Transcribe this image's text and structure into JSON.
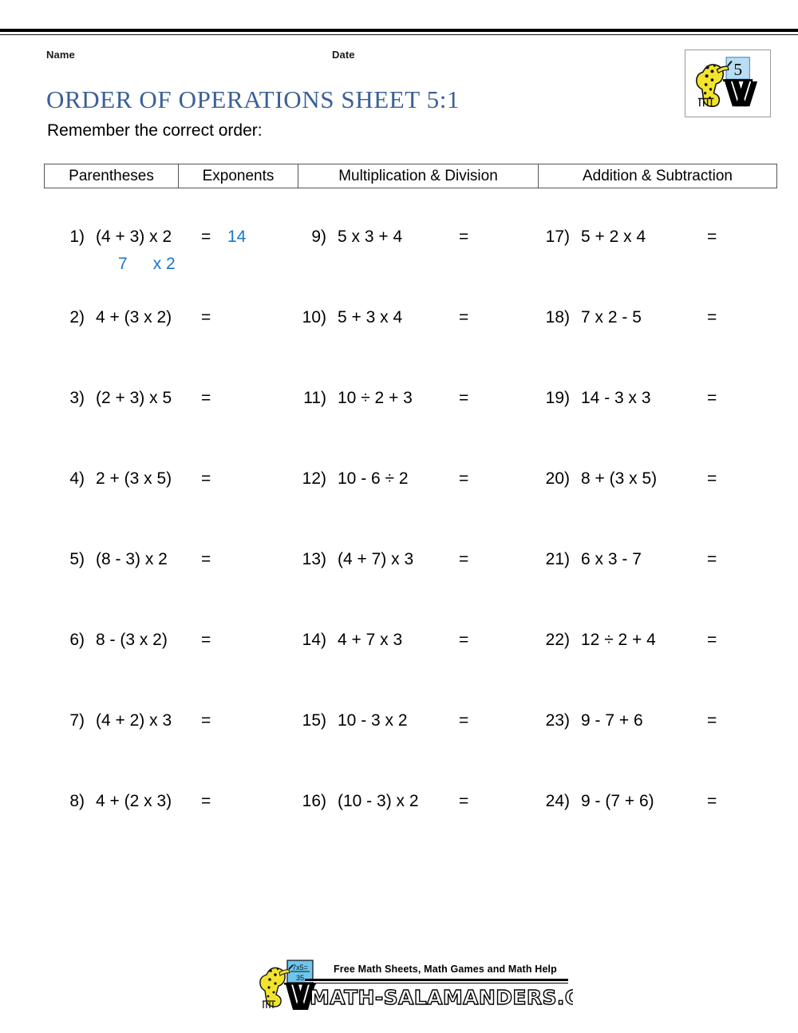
{
  "meta": {
    "name_label": "Name",
    "date_label": "Date"
  },
  "header": {
    "title": "ORDER OF OPERATIONS SHEET 5:1",
    "subtitle": "Remember the correct order:"
  },
  "order_table": {
    "cells": [
      "Parentheses",
      "Exponents",
      "Multiplication & Division",
      "Addition & Subtraction"
    ]
  },
  "badge": {
    "number": "5",
    "alt": "math-salamanders-grade-5-badge"
  },
  "colors": {
    "title_blue": "#3a6097",
    "answer_blue": "#1878c8",
    "board_blue": "#a8d8ef",
    "salamander_yellow": "#f2e42c",
    "rule_black": "#000000"
  },
  "columns": [
    {
      "rows": [
        {
          "num": "1)",
          "expr": "(4 + 3) x 2",
          "eq": "=",
          "answer": "14",
          "work": {
            "left": "7",
            "right": "x 2"
          }
        },
        {
          "num": "2)",
          "expr": "4 + (3 x 2)",
          "eq": "=",
          "answer": ""
        },
        {
          "num": "3)",
          "expr": "(2 + 3) x 5",
          "eq": "=",
          "answer": ""
        },
        {
          "num": "4)",
          "expr": "2 + (3 x 5)",
          "eq": "=",
          "answer": ""
        },
        {
          "num": "5)",
          "expr": "(8 - 3) x 2",
          "eq": "=",
          "answer": ""
        },
        {
          "num": "6)",
          "expr": "8 - (3 x 2)",
          "eq": "=",
          "answer": ""
        },
        {
          "num": "7)",
          "expr": "(4 + 2) x 3",
          "eq": "=",
          "answer": ""
        },
        {
          "num": "8)",
          "expr": "4 + (2 x 3)",
          "eq": "=",
          "answer": ""
        }
      ]
    },
    {
      "rows": [
        {
          "num": "9)",
          "expr": "5 x 3 + 4",
          "eq": "=",
          "answer": ""
        },
        {
          "num": "10)",
          "expr": "5 + 3 x 4",
          "eq": "=",
          "answer": ""
        },
        {
          "num": "11)",
          "expr": "10 ÷ 2 + 3",
          "eq": "=",
          "answer": ""
        },
        {
          "num": "12)",
          "expr": "10 - 6 ÷ 2",
          "eq": "=",
          "answer": ""
        },
        {
          "num": "13)",
          "expr": "(4 + 7) x 3",
          "eq": "=",
          "answer": ""
        },
        {
          "num": "14)",
          "expr": "4 + 7 x 3",
          "eq": "=",
          "answer": ""
        },
        {
          "num": "15)",
          "expr": "10 - 3 x 2",
          "eq": "=",
          "answer": ""
        },
        {
          "num": "16)",
          "expr": "(10 - 3) x 2",
          "eq": "=",
          "answer": ""
        }
      ]
    },
    {
      "rows": [
        {
          "num": "17)",
          "expr": "5 + 2 x 4",
          "eq": "=",
          "answer": ""
        },
        {
          "num": "18)",
          "expr": "7 x 2 - 5",
          "eq": "=",
          "answer": ""
        },
        {
          "num": "19)",
          "expr": "14 - 3 x 3",
          "eq": "=",
          "answer": ""
        },
        {
          "num": "20)",
          "expr": "8 + (3 x 5)",
          "eq": "=",
          "answer": ""
        },
        {
          "num": "21)",
          "expr": "6 x 3 - 7",
          "eq": "=",
          "answer": ""
        },
        {
          "num": "22)",
          "expr": "12 ÷ 2 + 4",
          "eq": "=",
          "answer": ""
        },
        {
          "num": "23)",
          "expr": "9 - 7 + 6",
          "eq": "=",
          "answer": ""
        },
        {
          "num": "24)",
          "expr": "9 - (7 + 6)",
          "eq": "=",
          "answer": ""
        }
      ]
    }
  ],
  "footer": {
    "tagline": "Free Math Sheets, Math Games and Math Help",
    "domain": "MATH-SALAMANDERS.COM",
    "board_text_top": "7x5=",
    "board_text_bottom": "35"
  }
}
